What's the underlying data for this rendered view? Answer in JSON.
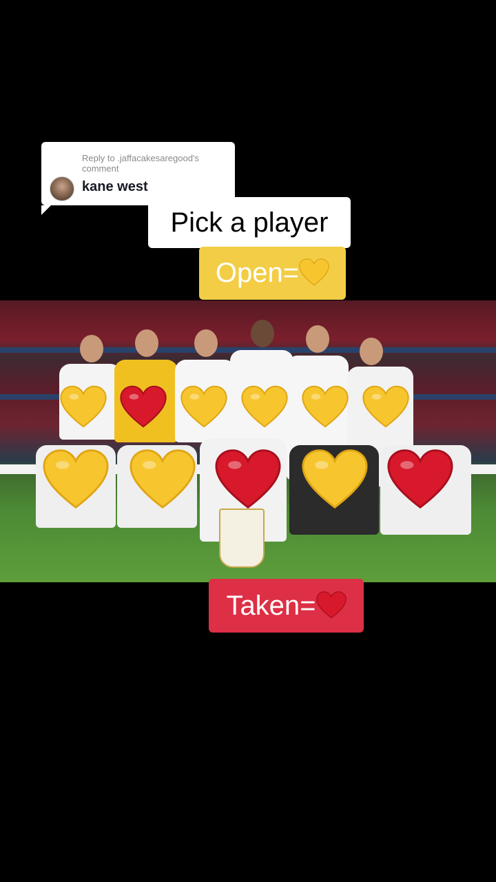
{
  "reply": {
    "meta": "Reply to .jaffacakesaregood's comment",
    "text": "kane west"
  },
  "captions": {
    "title": "Pick a player",
    "open_label": "Open=",
    "taken_label": "Taken="
  },
  "colors": {
    "open_heart": "#f7c62f",
    "taken_heart": "#d7192b",
    "open_caption_bg": "#f2cd45",
    "taken_caption_bg": "#dd2f45"
  },
  "icons": {
    "open": "yellow-heart-icon",
    "taken": "red-heart-icon"
  },
  "team_photo": {
    "back_row": [
      "open",
      "taken",
      "open",
      "open",
      "open",
      "open"
    ],
    "front_row": [
      "open",
      "open",
      "taken",
      "open",
      "taken"
    ]
  }
}
